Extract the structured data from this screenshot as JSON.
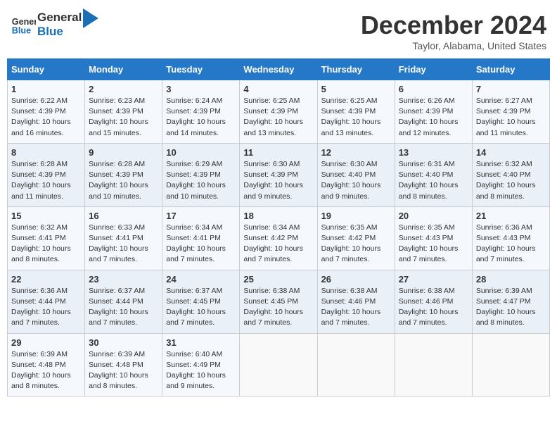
{
  "header": {
    "logo_line1": "General",
    "logo_line2": "Blue",
    "month_title": "December 2024",
    "subtitle": "Taylor, Alabama, United States"
  },
  "days_of_week": [
    "Sunday",
    "Monday",
    "Tuesday",
    "Wednesday",
    "Thursday",
    "Friday",
    "Saturday"
  ],
  "weeks": [
    [
      {
        "day": "1",
        "detail": "Sunrise: 6:22 AM\nSunset: 4:39 PM\nDaylight: 10 hours\nand 16 minutes."
      },
      {
        "day": "2",
        "detail": "Sunrise: 6:23 AM\nSunset: 4:39 PM\nDaylight: 10 hours\nand 15 minutes."
      },
      {
        "day": "3",
        "detail": "Sunrise: 6:24 AM\nSunset: 4:39 PM\nDaylight: 10 hours\nand 14 minutes."
      },
      {
        "day": "4",
        "detail": "Sunrise: 6:25 AM\nSunset: 4:39 PM\nDaylight: 10 hours\nand 13 minutes."
      },
      {
        "day": "5",
        "detail": "Sunrise: 6:25 AM\nSunset: 4:39 PM\nDaylight: 10 hours\nand 13 minutes."
      },
      {
        "day": "6",
        "detail": "Sunrise: 6:26 AM\nSunset: 4:39 PM\nDaylight: 10 hours\nand 12 minutes."
      },
      {
        "day": "7",
        "detail": "Sunrise: 6:27 AM\nSunset: 4:39 PM\nDaylight: 10 hours\nand 11 minutes."
      }
    ],
    [
      {
        "day": "8",
        "detail": "Sunrise: 6:28 AM\nSunset: 4:39 PM\nDaylight: 10 hours\nand 11 minutes."
      },
      {
        "day": "9",
        "detail": "Sunrise: 6:28 AM\nSunset: 4:39 PM\nDaylight: 10 hours\nand 10 minutes."
      },
      {
        "day": "10",
        "detail": "Sunrise: 6:29 AM\nSunset: 4:39 PM\nDaylight: 10 hours\nand 10 minutes."
      },
      {
        "day": "11",
        "detail": "Sunrise: 6:30 AM\nSunset: 4:39 PM\nDaylight: 10 hours\nand 9 minutes."
      },
      {
        "day": "12",
        "detail": "Sunrise: 6:30 AM\nSunset: 4:40 PM\nDaylight: 10 hours\nand 9 minutes."
      },
      {
        "day": "13",
        "detail": "Sunrise: 6:31 AM\nSunset: 4:40 PM\nDaylight: 10 hours\nand 8 minutes."
      },
      {
        "day": "14",
        "detail": "Sunrise: 6:32 AM\nSunset: 4:40 PM\nDaylight: 10 hours\nand 8 minutes."
      }
    ],
    [
      {
        "day": "15",
        "detail": "Sunrise: 6:32 AM\nSunset: 4:41 PM\nDaylight: 10 hours\nand 8 minutes."
      },
      {
        "day": "16",
        "detail": "Sunrise: 6:33 AM\nSunset: 4:41 PM\nDaylight: 10 hours\nand 7 minutes."
      },
      {
        "day": "17",
        "detail": "Sunrise: 6:34 AM\nSunset: 4:41 PM\nDaylight: 10 hours\nand 7 minutes."
      },
      {
        "day": "18",
        "detail": "Sunrise: 6:34 AM\nSunset: 4:42 PM\nDaylight: 10 hours\nand 7 minutes."
      },
      {
        "day": "19",
        "detail": "Sunrise: 6:35 AM\nSunset: 4:42 PM\nDaylight: 10 hours\nand 7 minutes."
      },
      {
        "day": "20",
        "detail": "Sunrise: 6:35 AM\nSunset: 4:43 PM\nDaylight: 10 hours\nand 7 minutes."
      },
      {
        "day": "21",
        "detail": "Sunrise: 6:36 AM\nSunset: 4:43 PM\nDaylight: 10 hours\nand 7 minutes."
      }
    ],
    [
      {
        "day": "22",
        "detail": "Sunrise: 6:36 AM\nSunset: 4:44 PM\nDaylight: 10 hours\nand 7 minutes."
      },
      {
        "day": "23",
        "detail": "Sunrise: 6:37 AM\nSunset: 4:44 PM\nDaylight: 10 hours\nand 7 minutes."
      },
      {
        "day": "24",
        "detail": "Sunrise: 6:37 AM\nSunset: 4:45 PM\nDaylight: 10 hours\nand 7 minutes."
      },
      {
        "day": "25",
        "detail": "Sunrise: 6:38 AM\nSunset: 4:45 PM\nDaylight: 10 hours\nand 7 minutes."
      },
      {
        "day": "26",
        "detail": "Sunrise: 6:38 AM\nSunset: 4:46 PM\nDaylight: 10 hours\nand 7 minutes."
      },
      {
        "day": "27",
        "detail": "Sunrise: 6:38 AM\nSunset: 4:46 PM\nDaylight: 10 hours\nand 7 minutes."
      },
      {
        "day": "28",
        "detail": "Sunrise: 6:39 AM\nSunset: 4:47 PM\nDaylight: 10 hours\nand 8 minutes."
      }
    ],
    [
      {
        "day": "29",
        "detail": "Sunrise: 6:39 AM\nSunset: 4:48 PM\nDaylight: 10 hours\nand 8 minutes."
      },
      {
        "day": "30",
        "detail": "Sunrise: 6:39 AM\nSunset: 4:48 PM\nDaylight: 10 hours\nand 8 minutes."
      },
      {
        "day": "31",
        "detail": "Sunrise: 6:40 AM\nSunset: 4:49 PM\nDaylight: 10 hours\nand 9 minutes."
      },
      {
        "day": "",
        "detail": ""
      },
      {
        "day": "",
        "detail": ""
      },
      {
        "day": "",
        "detail": ""
      },
      {
        "day": "",
        "detail": ""
      }
    ]
  ]
}
